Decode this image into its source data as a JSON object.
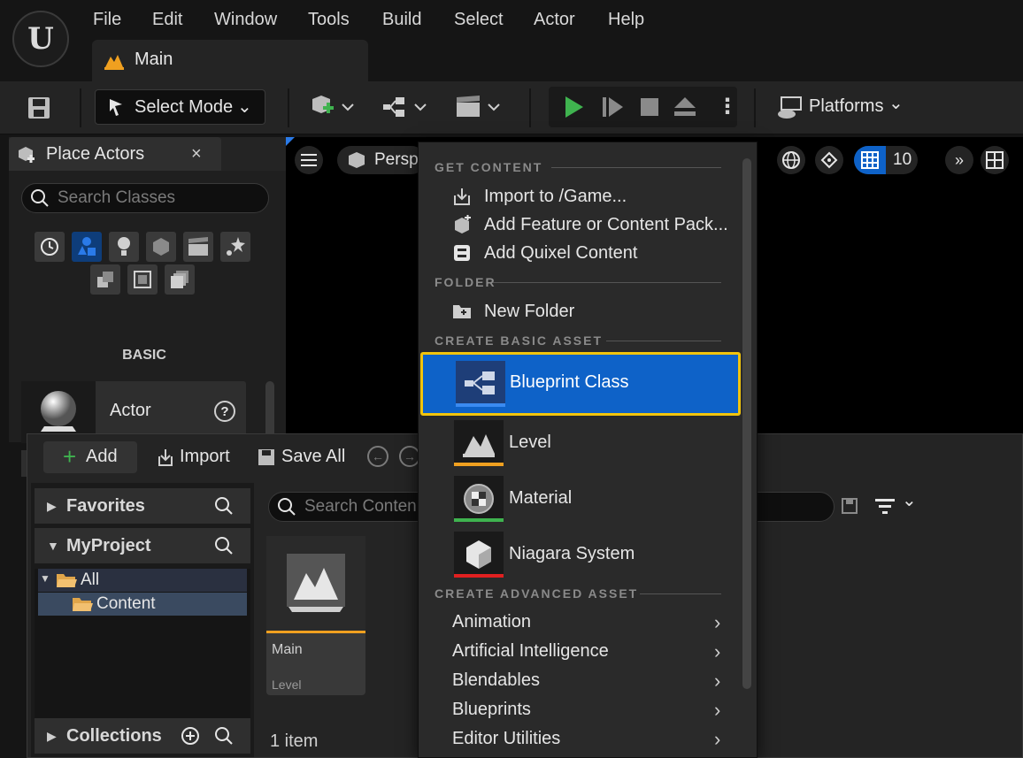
{
  "menu": [
    "File",
    "Edit",
    "Window",
    "Tools",
    "Build",
    "Select",
    "Actor",
    "Help"
  ],
  "logo_text": "U",
  "main_tab": {
    "label": "Main"
  },
  "toolbar": {
    "select_mode": "Select Mode",
    "platforms": "Platforms"
  },
  "place_actors": {
    "title": "Place Actors",
    "close": "×",
    "search_placeholder": "Search Classes",
    "category": "BASIC",
    "items": [
      {
        "label": "Actor"
      }
    ]
  },
  "viewport": {
    "perspective": "Persp",
    "grid_value": "10"
  },
  "content_browser": {
    "add": "Add",
    "import": "Import",
    "save_all": "Save All",
    "favorites": "Favorites",
    "project": "MyProject",
    "tree": [
      "All",
      "Content"
    ],
    "collections": "Collections",
    "search_placeholder": "Search Conten",
    "asset": {
      "name": "Main",
      "type": "Level"
    },
    "item_count": "1 item"
  },
  "context_menu": {
    "get_content": {
      "header": "GET CONTENT",
      "items": [
        "Import to /Game...",
        "Add Feature or Content Pack...",
        "Add Quixel Content"
      ]
    },
    "folder": {
      "header": "FOLDER",
      "items": [
        "New Folder"
      ]
    },
    "basic": {
      "header": "CREATE BASIC ASSET",
      "items": [
        {
          "label": "Blueprint Class",
          "color": "#0e62c8"
        },
        {
          "label": "Level",
          "color": "#f0a020"
        },
        {
          "label": "Material",
          "color": "#3fb34f"
        },
        {
          "label": "Niagara System",
          "color": "#e02020"
        }
      ]
    },
    "advanced": {
      "header": "CREATE ADVANCED ASSET",
      "items": [
        "Animation",
        "Artificial Intelligence",
        "Blendables",
        "Blueprints",
        "Editor Utilities"
      ]
    }
  },
  "colors": {
    "accent": "#0e62c8",
    "highlight_border": "#f2c40c",
    "play": "#3fb34f"
  }
}
